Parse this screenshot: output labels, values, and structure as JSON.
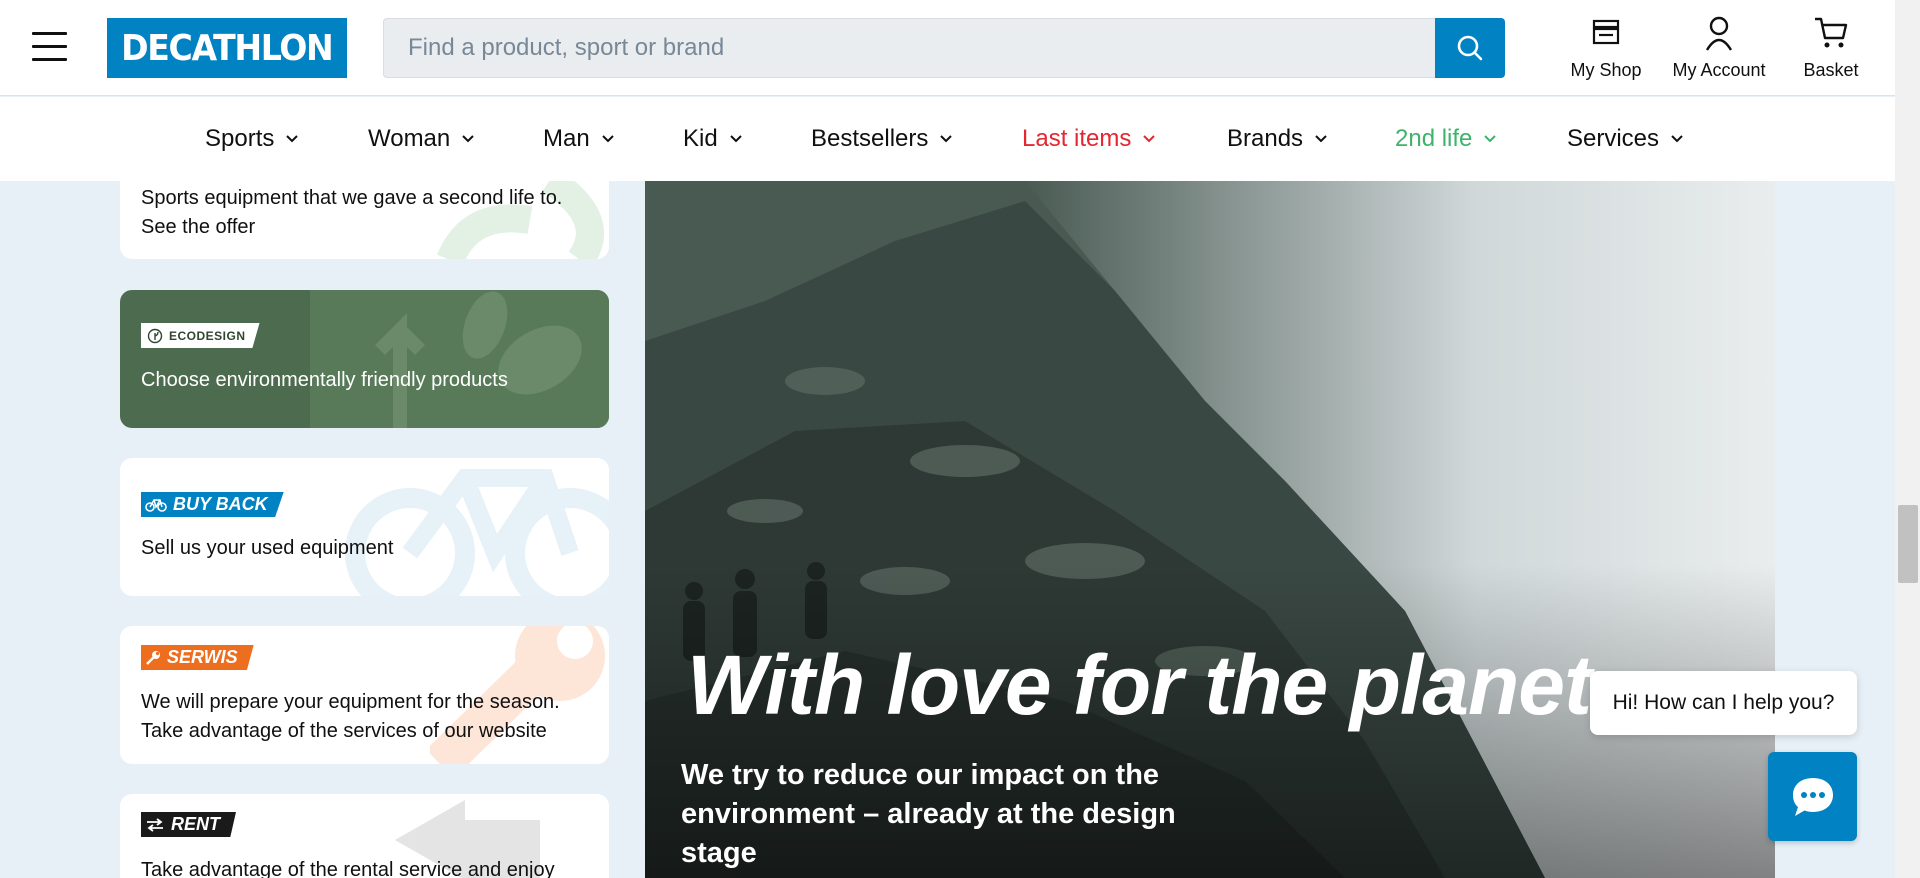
{
  "header": {
    "menu_icon": "hamburger-menu-icon",
    "logo_text": "DECATHLON",
    "search_placeholder": "Find a product, sport or brand",
    "search_icon": "search-icon",
    "actions": [
      {
        "label": "My Shop",
        "icon": "shop-icon"
      },
      {
        "label": "My Account",
        "icon": "account-icon"
      },
      {
        "label": "Basket",
        "icon": "basket-icon"
      }
    ]
  },
  "nav": {
    "items": [
      {
        "label": "Sports",
        "color": "#101010"
      },
      {
        "label": "Woman",
        "color": "#101010"
      },
      {
        "label": "Man",
        "color": "#101010"
      },
      {
        "label": "Kid",
        "color": "#101010"
      },
      {
        "label": "Bestsellers",
        "color": "#101010"
      },
      {
        "label": "Last items",
        "color": "#e3262f"
      },
      {
        "label": "Brands",
        "color": "#101010"
      },
      {
        "label": "2nd life",
        "color": "#3eb36b"
      },
      {
        "label": "Services",
        "color": "#101010"
      }
    ]
  },
  "cards": {
    "second_life": {
      "line1": "Sports equipment that we gave a second life to.",
      "line2": "See the offer"
    },
    "ecodesign": {
      "tag": "ECODESIGN",
      "text": "Choose environmentally friendly products",
      "bg_color": "#4d6b4e"
    },
    "buy_back": {
      "tag": "BUY BACK",
      "text": "Sell us your used equipment",
      "tag_color": "#0082c3"
    },
    "serwis": {
      "tag": "SERWIS",
      "line1": "We will prepare your equipment for the season.",
      "line2": "Take advantage of the services of our website",
      "tag_color": "#ec6e1e"
    },
    "rent": {
      "tag": "RENT",
      "text": "Take advantage of the rental service and enjoy",
      "tag_color": "#1a1a1a"
    }
  },
  "hero": {
    "title": "With love for the planet",
    "subtitle": "We try to reduce our impact on the environment – already at the design stage"
  },
  "chat": {
    "bubble_text": "Hi! How can I help you?",
    "button_icon": "chat-icon"
  }
}
